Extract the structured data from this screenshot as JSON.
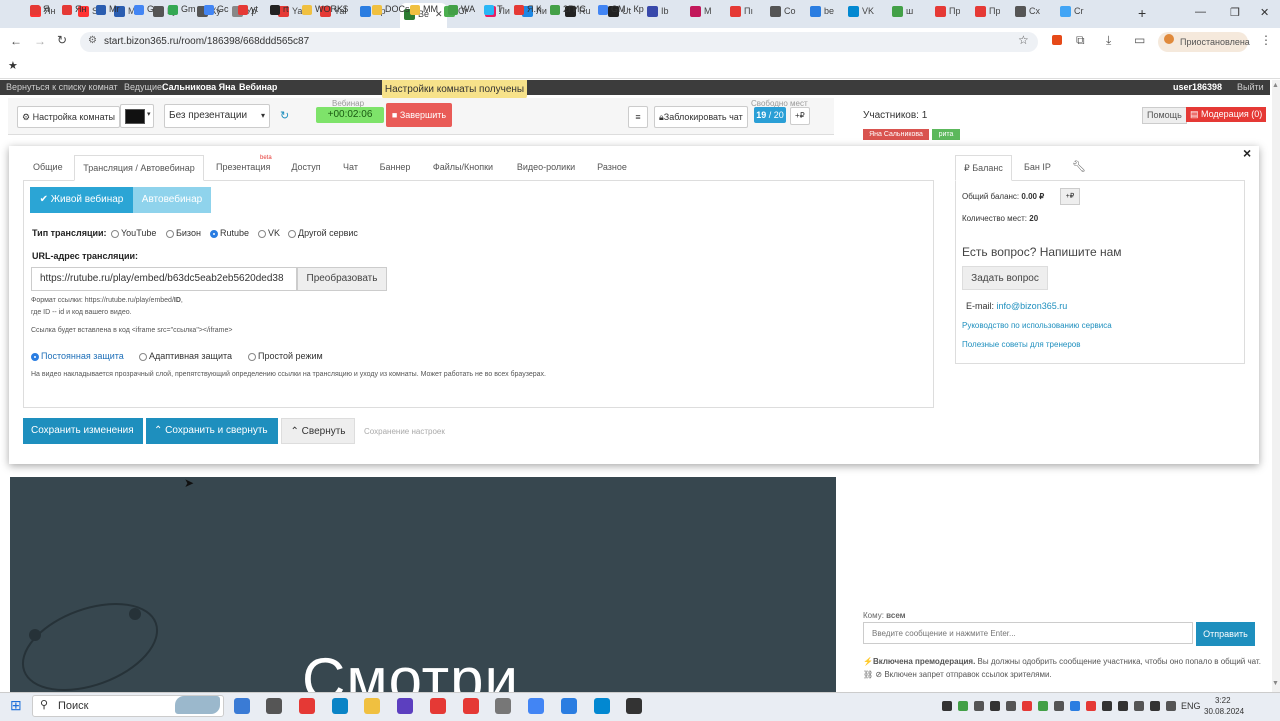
{
  "browser": {
    "tabs": [
      {
        "label": "Ян",
        "color": "#ff3333"
      },
      {
        "label": "Sa",
        "color": "#ff3333"
      },
      {
        "label": "Mr",
        "color": "#2a5db0"
      },
      {
        "label": "Ку",
        "color": "#555555"
      },
      {
        "label": "Ку",
        "color": "#555555"
      },
      {
        "label": "Ур",
        "color": "#888888"
      },
      {
        "label": "Yai",
        "color": "#e53935"
      },
      {
        "label": "Yai",
        "color": "#e53935"
      },
      {
        "label": "Up",
        "color": "#2a7de1"
      },
      {
        "label": "Be",
        "color": "#2e7d32"
      },
      {
        "label": "Cr",
        "color": "#4caf50"
      },
      {
        "label": "Ли",
        "color": "#e91e63"
      },
      {
        "label": "Ли",
        "color": "#1e88e5"
      },
      {
        "label": "Ru",
        "color": "#222222"
      },
      {
        "label": "Ut",
        "color": "#222222"
      },
      {
        "label": "Ib",
        "color": "#3949ab"
      },
      {
        "label": "M",
        "color": "#c2185b"
      },
      {
        "label": "Пı",
        "color": "#e53935"
      },
      {
        "label": "Co",
        "color": "#555555"
      },
      {
        "label": "be",
        "color": "#2a7de1"
      },
      {
        "label": "VK",
        "color": "#0288d1"
      },
      {
        "label": "ш",
        "color": "#43a047"
      },
      {
        "label": "Пр",
        "color": "#e53935"
      },
      {
        "label": "Пр",
        "color": "#e53935"
      },
      {
        "label": "Cx",
        "color": "#555555"
      },
      {
        "label": "Cr",
        "color": "#42a5f5"
      }
    ],
    "new_tab": "+",
    "url": "start.bizon365.ru/room/186398/668ddd565c87",
    "profile_label": "Приостановлена",
    "bookmarks": [
      {
        "label": "Я",
        "color": "#e53935"
      },
      {
        "label": "Ян",
        "color": "#e53935"
      },
      {
        "label": "Mr",
        "color": "#2a5db0"
      },
      {
        "label": "G",
        "color": "#4285f4"
      },
      {
        "label": "Gm",
        "color": "#34a853"
      },
      {
        "label": "Gc",
        "color": "#4285f4"
      },
      {
        "label": "yt",
        "color": "#e53935"
      },
      {
        "label": "rt",
        "color": "#222222"
      },
      {
        "label": "WORK$",
        "color": "#f0c040"
      },
      {
        "label": "DOCs",
        "color": "#f0c040"
      },
      {
        "label": "MM",
        "color": "#f0c040"
      },
      {
        "label": "WA",
        "color": "#43a047"
      },
      {
        "label": "T",
        "color": "#29b6f6"
      },
      {
        "label": "Я.К",
        "color": "#e53935"
      },
      {
        "label": "2ГИС",
        "color": "#43a047"
      },
      {
        "label": "GM - Кр",
        "color": "#4285f4"
      }
    ]
  },
  "app": {
    "back_link": "Вернуться к списку комнат",
    "host_label": "Ведущие:",
    "host_name": "Сальникова Яна",
    "webinar_label": "Вебинар",
    "notice": "Настройки комнаты получены",
    "user": "user186398",
    "logout": "Выйти"
  },
  "toolbar": {
    "room_settings": "Настройка комнаты",
    "presentation_select": "Без презентации",
    "timer_caption": "Вебинар",
    "timer": "+00:02:06",
    "finish": "Завершить",
    "lock_chat": "Заблокировать чат",
    "seats_caption": "Свободно мест",
    "seats_value": "19",
    "seats_total": "/ 20",
    "seats_add": "+₽"
  },
  "right": {
    "participants": "Участников: 1",
    "help": "Помощь",
    "moderation": "Модерация (0)",
    "tag_host": "Яна Сальникова",
    "tag_guest": "рита"
  },
  "modal": {
    "close": "×",
    "tabs": [
      "Общие",
      "Трансляция / Автовебинар",
      "Презентация",
      "Доступ",
      "Чат",
      "Баннер",
      "Файлы/Кнопки",
      "Видео-ролики",
      "Разное"
    ],
    "beta": "beta",
    "mode_live": "Живой вебинар",
    "mode_auto": "Автовебинар",
    "stream_type_label": "Тип трансляции:",
    "stream_types": [
      "YouTube",
      "Бизон",
      "Rutube",
      "VK",
      "Другой сервис"
    ],
    "url_label": "URL-адрес трансляции:",
    "url_value": "https://rutube.ru/play/embed/b63dc5eab2eb5620ded38",
    "convert": "Преобразовать",
    "hint1_prefix": "Формат ссылки: https://rutube.ru/play/embed/",
    "hint1_bold": "ID",
    "hint1_suffix": ",",
    "hint2": "где ID -- id и код вашего видео.",
    "hint3": "Ссылка будет вставлена в код <iframe src=\"ссылка\"></iframe>",
    "protection": [
      "Постоянная защита",
      "Адаптивная защита",
      "Простой режим"
    ],
    "protection_note": "На видео накладывается прозрачный слой, препятствующий определению ссылки на трансляцию и уходу из комнаты. Может работать не во всех браузерах.",
    "save": "Сохранить изменения",
    "save_collapse": "Сохранить и свернуть",
    "collapse": "Свернуть",
    "saving_status": "Сохранение настроек",
    "side_tabs": [
      "₽ Баланс",
      "Бан IP"
    ],
    "balance_label": "Общий баланс:",
    "balance_value": "0.00 ₽",
    "balance_add": "+₽",
    "seats_label": "Количество мест:",
    "seats_value": "20",
    "question_title": "Есть вопрос? Напишите нам",
    "ask_button": "Задать вопрос",
    "email_label": "E-mail:",
    "email_value": "info@bizon365.ru",
    "guide_link": "Руководство по использованию сервиса",
    "tips_link": "Полезные советы для тренеров"
  },
  "chat": {
    "to_label": "Кому:",
    "to_value": "всем",
    "placeholder": "Введите сообщение и нажмите Enter...",
    "send": "Отправить",
    "premod_bold": "Включена премодерация.",
    "premod_text": "Вы должны одобрить сообщение участника, чтобы оно попало в общий чат.",
    "links_note": "Включен запрет отправок ссылок зрителями."
  },
  "video": {
    "overlay_text": "Смотри"
  },
  "taskbar": {
    "search": "Поиск",
    "lang": "ENG",
    "time": "3:22",
    "date": "30.08.2024"
  }
}
